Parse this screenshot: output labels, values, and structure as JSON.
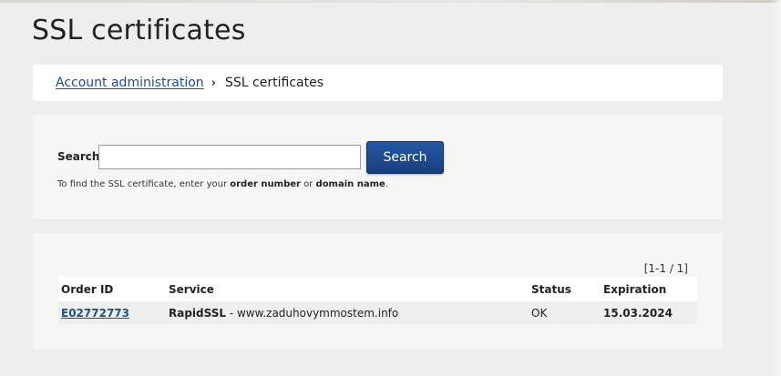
{
  "page": {
    "title": "SSL certificates"
  },
  "breadcrumb": {
    "parent_label": "Account administration",
    "separator": "›",
    "current_label": "SSL certificates"
  },
  "search": {
    "label": "Search",
    "value": "",
    "placeholder": "",
    "button_label": "Search",
    "hint_prefix": "To find the SSL certificate, enter your ",
    "hint_term1": "order number",
    "hint_middle": " or ",
    "hint_term2": "domain name",
    "hint_suffix": "."
  },
  "results": {
    "pager": "[1-1 / 1]",
    "columns": {
      "order_id": "Order ID",
      "service": "Service",
      "status": "Status",
      "expiration": "Expiration"
    },
    "rows": [
      {
        "order_id": "E02772773",
        "service_name": "RapidSSL",
        "service_domain": " - www.zaduhovymmostem.info",
        "status": "OK",
        "expiration": "15.03.2024"
      }
    ]
  },
  "colors": {
    "link": "#1a4f96",
    "button": "#1f4f96",
    "background": "#eeeeed"
  }
}
